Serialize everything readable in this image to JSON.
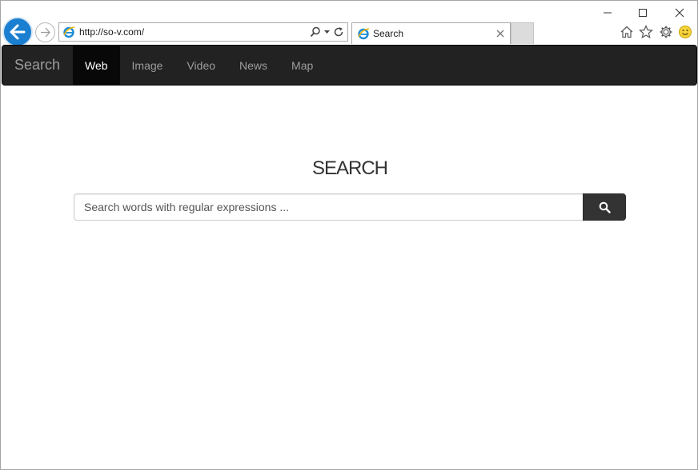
{
  "browser": {
    "address_url": "http://so-v.com/",
    "tab_title": "Search",
    "icons": {
      "back": "back-arrow-icon",
      "forward": "forward-arrow-icon",
      "site": "ie-logo-icon",
      "search": "search-icon",
      "dropdown": "chevron-down-icon",
      "refresh": "refresh-icon",
      "close_tab": "close-icon",
      "home": "home-icon",
      "favorites": "star-icon",
      "settings": "gear-icon",
      "feedback": "smiley-icon"
    },
    "accent_color": "#1a7fd1"
  },
  "window": {
    "controls": [
      "minimize",
      "maximize",
      "close"
    ]
  },
  "navbar": {
    "brand": "Search",
    "items": [
      {
        "label": "Web",
        "active": true
      },
      {
        "label": "Image",
        "active": false
      },
      {
        "label": "Video",
        "active": false
      },
      {
        "label": "News",
        "active": false
      },
      {
        "label": "Map",
        "active": false
      }
    ],
    "background": "#222222",
    "active_background": "#080808"
  },
  "main": {
    "title": "SEARCH",
    "search": {
      "placeholder": "Search words with regular expressions ...",
      "value": "",
      "button_icon": "search-icon",
      "button_color": "#333333"
    }
  }
}
